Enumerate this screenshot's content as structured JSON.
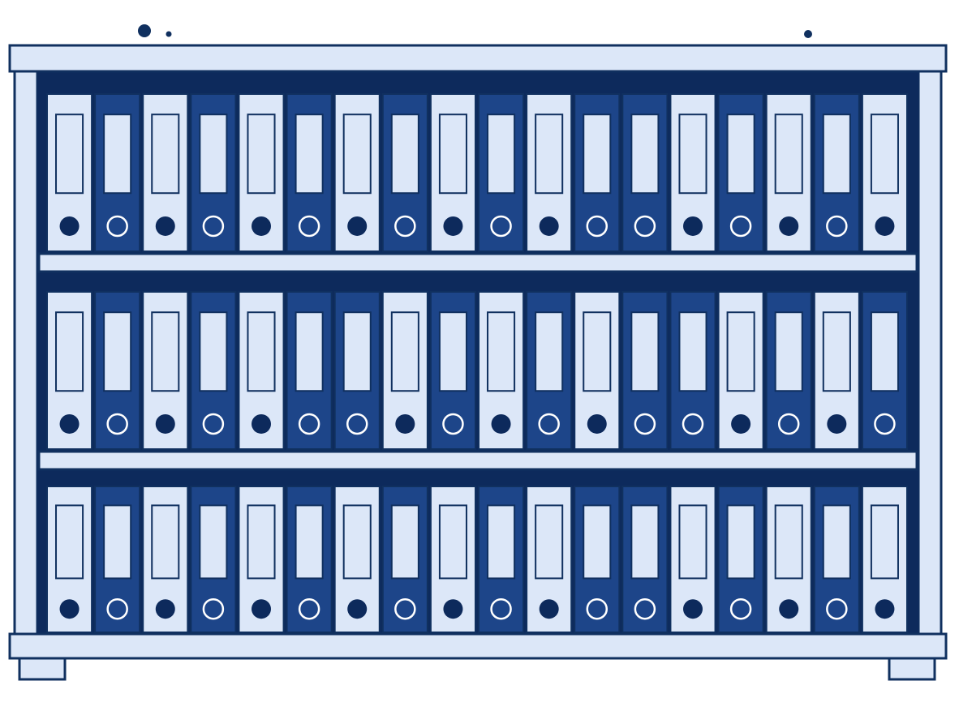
{
  "illustration": {
    "subject": "bookshelf-with-binders",
    "colors": {
      "background": "#ffffff",
      "outline": "#10305f",
      "frame_light": "#dce7f8",
      "cabinet_interior": "#0d2a5c",
      "binder_dark": "#1d4589",
      "binder_light": "#dce7f8",
      "ring_dark": "#0d2a5c",
      "ring_light": "#ffffff"
    },
    "shelves": [
      {
        "id": "top",
        "binders": [
          "light",
          "dark",
          "light",
          "dark",
          "light",
          "dark",
          "light",
          "dark",
          "light",
          "dark",
          "light",
          "dark",
          "dark",
          "light",
          "dark",
          "light",
          "dark",
          "light"
        ]
      },
      {
        "id": "middle",
        "binders": [
          "light",
          "dark",
          "light",
          "dark",
          "light",
          "dark",
          "dark",
          "light",
          "dark",
          "light",
          "dark",
          "light",
          "dark",
          "dark",
          "light",
          "dark",
          "light",
          "dark"
        ]
      },
      {
        "id": "bottom",
        "binders": [
          "light",
          "dark",
          "light",
          "dark",
          "light",
          "dark",
          "light",
          "dark",
          "light",
          "dark",
          "light",
          "dark",
          "dark",
          "light",
          "dark",
          "light",
          "dark",
          "light"
        ]
      }
    ]
  }
}
